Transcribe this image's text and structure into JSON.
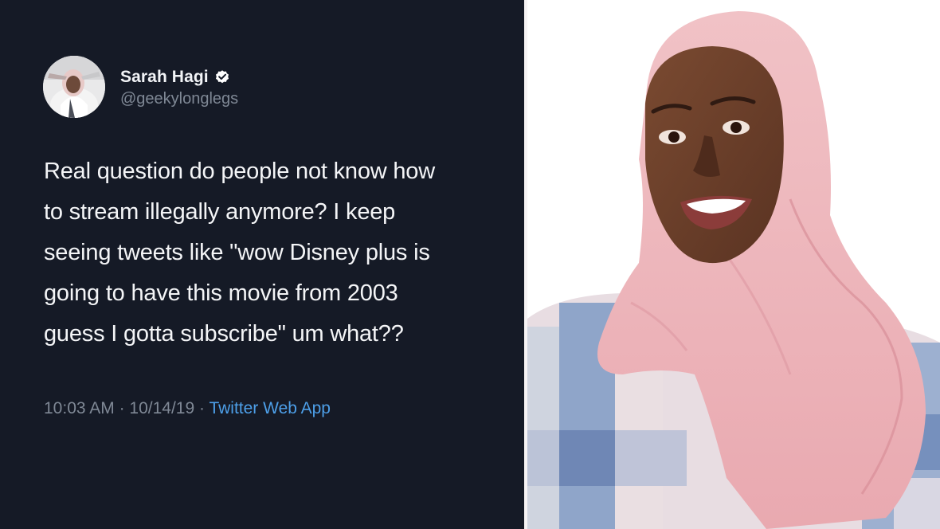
{
  "tweet": {
    "display_name": "Sarah Hagi",
    "handle": "@geekylonglegs",
    "verified_icon": "verified-badge-icon",
    "text_lines": [
      "Real question do people not know how",
      "to stream illegally anymore? I keep",
      "seeing tweets like \"wow Disney plus is",
      "going to have this movie from 2003",
      "guess I gotta subscribe\" um what??"
    ],
    "time": "10:03 AM",
    "sep1": " · ",
    "date": "10/14/19",
    "sep2": " · ",
    "source": "Twitter Web App"
  },
  "colors": {
    "card_bg": "#151a26",
    "text": "#f4f5f7",
    "muted": "#7f8895",
    "link": "#4d9fe8",
    "verified": "#ffffff"
  }
}
